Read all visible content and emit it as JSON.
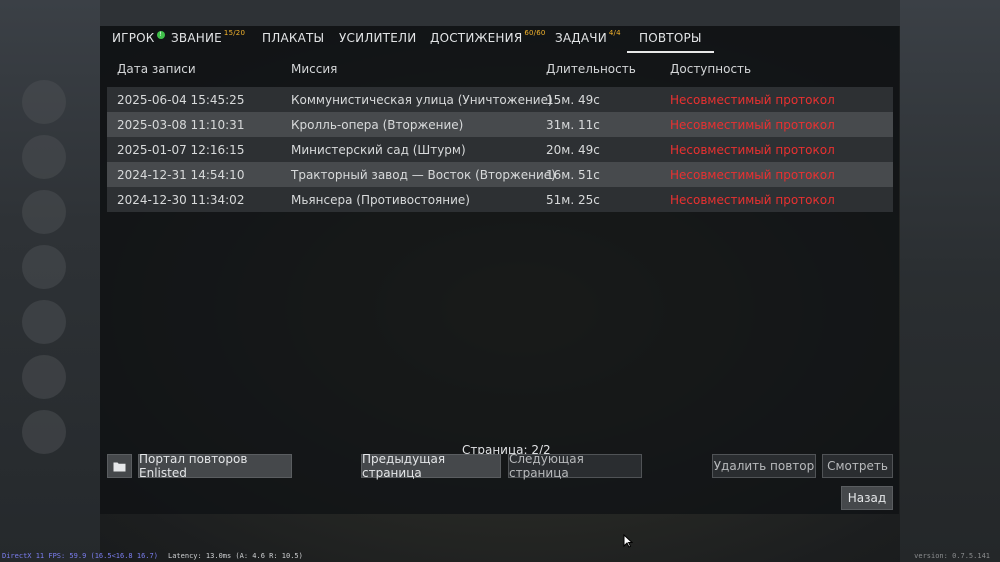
{
  "tabs": [
    {
      "label": "ИГРОК",
      "badge": "!"
    },
    {
      "label": "ЗВАНИЕ",
      "sup": "15/20"
    },
    {
      "label": "ПЛАКАТЫ"
    },
    {
      "label": "УСИЛИТЕЛИ"
    },
    {
      "label": "ДОСТИЖЕНИЯ",
      "sup": "60/60"
    },
    {
      "label": "ЗАДАЧИ",
      "sup": "4/4"
    },
    {
      "label": "ПОВТОРЫ",
      "active": true
    }
  ],
  "table": {
    "headers": [
      "Дата записи",
      "Миссия",
      "Длительность",
      "Доступность"
    ],
    "rows": [
      {
        "date": "2025-06-04 15:45:25",
        "mission": "Коммунистическая улица (Уничтожение)",
        "duration": "15м. 49с",
        "availability": "Несовместимый протокол"
      },
      {
        "date": "2025-03-08 11:10:31",
        "mission": "Кролль-опера (Вторжение)",
        "duration": "31м. 11с",
        "availability": "Несовместимый протокол"
      },
      {
        "date": "2025-01-07 12:16:15",
        "mission": "Министерский сад (Штурм)",
        "duration": "20м. 49с",
        "availability": "Несовместимый протокол"
      },
      {
        "date": "2024-12-31 14:54:10",
        "mission": "Тракторный завод — Восток (Вторжение)",
        "duration": "16м. 51с",
        "availability": "Несовместимый протокол"
      },
      {
        "date": "2024-12-30 11:34:02",
        "mission": "Мьянсера (Противостояние)",
        "duration": "51м. 25с",
        "availability": "Несовместимый протокол"
      }
    ]
  },
  "pagination": {
    "label": "Страница: 2/2",
    "prev": "Предыдущая страница",
    "next": "Следующая страница"
  },
  "buttons": {
    "folder_icon": "folder-icon",
    "portal": "Портал повторов Enlisted",
    "delete": "Удалить повтор",
    "watch": "Смотреть",
    "back": "Назад"
  },
  "status_bar": {
    "fps": "DirectX 11 FPS: 59.9 (16.5<16.8 16.7)",
    "latency": "Latency: 13.0ms (A: 4.6 R: 10.5)",
    "version": "version: 0.7.5.141"
  },
  "colors": {
    "accent": "#f3b32c",
    "error": "#ea3030",
    "badge": "#3fbf4a"
  }
}
